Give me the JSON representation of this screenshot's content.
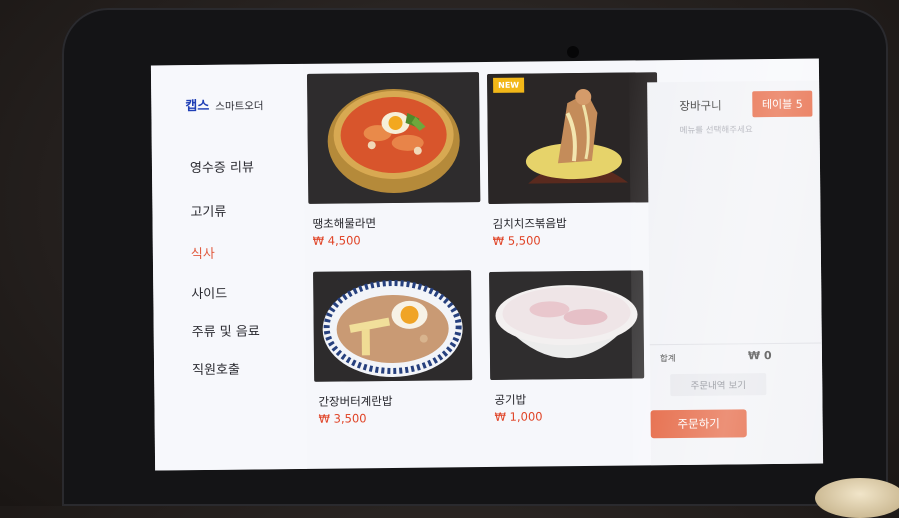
{
  "brand": {
    "name": "캡스",
    "subtitle": "스마트오더"
  },
  "sidebar": {
    "items": [
      {
        "label": "영수증 리뷰",
        "active": false
      },
      {
        "label": "고기류",
        "active": false
      },
      {
        "label": "식사",
        "active": true
      },
      {
        "label": "사이드",
        "active": false
      },
      {
        "label": "주류 및 음료",
        "active": false
      },
      {
        "label": "직원호출",
        "active": false
      }
    ]
  },
  "menu": {
    "items": [
      {
        "name": "땡초해물라면",
        "price": "₩ 4,500",
        "image_icon": "ramen-bowl-icon"
      },
      {
        "name": "김치치즈볶음밥",
        "price": "₩ 5,500",
        "badge": "NEW",
        "image_icon": "cheese-rice-icon"
      },
      {
        "name": "간장버터계란밥",
        "price": "₩ 3,500",
        "image_icon": "egg-rice-bowl-icon"
      },
      {
        "name": "공기밥",
        "price": "₩ 1,000",
        "image_icon": "rice-bowl-icon"
      }
    ]
  },
  "cart": {
    "title": "장바구니",
    "table_label": "테이블 5",
    "hint": "메뉴를 선택해주세요",
    "total_label": "합계",
    "total_value": "₩ 0",
    "history_button": "주문내역 보기",
    "order_button": "주문하기"
  },
  "colors": {
    "accent": "#e4572f",
    "price": "#e04427",
    "brand": "#1f3fb6",
    "new_badge": "#f2b718"
  }
}
